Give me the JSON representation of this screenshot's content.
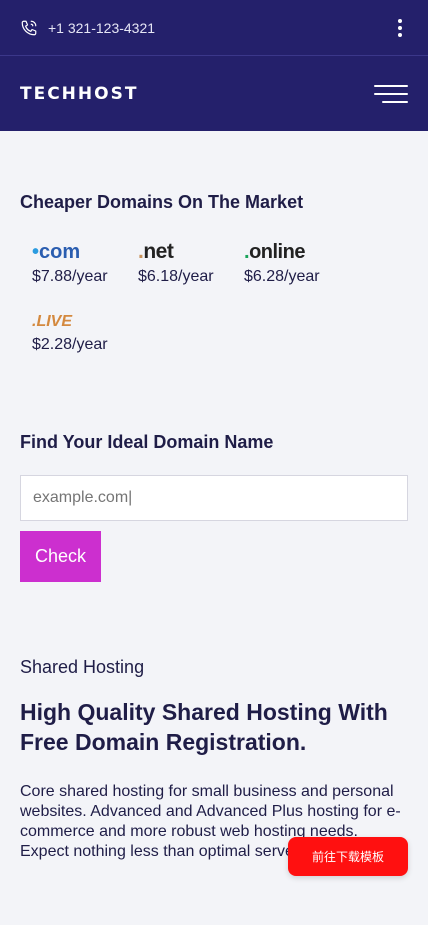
{
  "topbar": {
    "phone": "+1 321-123-4321"
  },
  "nav": {
    "logo": "TECHHOST"
  },
  "domains": {
    "title": "Cheaper Domains On The Market",
    "items": [
      {
        "dot": "•",
        "ext": "com",
        "price": "$7.88/year"
      },
      {
        "dot": ".",
        "ext": "net",
        "price": "$6.18/year"
      },
      {
        "dot": ".",
        "ext": "online",
        "price": "$6.28/year"
      },
      {
        "dot": ".",
        "ext": "LIVE",
        "price": "$2.28/year"
      }
    ]
  },
  "search": {
    "title": "Find Your Ideal Domain Name",
    "placeholder": "example.com|",
    "button": "Check"
  },
  "hosting": {
    "eyebrow": "Shared Hosting",
    "title": "High Quality Shared Hosting With Free Domain Registration.",
    "description": "Core shared hosting for small business and personal websites. Advanced and Advanced Plus hosting for e-commerce and more robust web hosting needs. Expect nothing less than optimal server stability."
  },
  "floating": {
    "label": "前往下载模板"
  },
  "colors": {
    "header_bg": "#24206b",
    "page_bg": "#f3f4f8",
    "check_button": "#cc2fcf",
    "floating_button": "#ff1010"
  },
  "icons": [
    "phone-icon",
    "kebab-menu-icon",
    "hamburger-menu-icon"
  ]
}
